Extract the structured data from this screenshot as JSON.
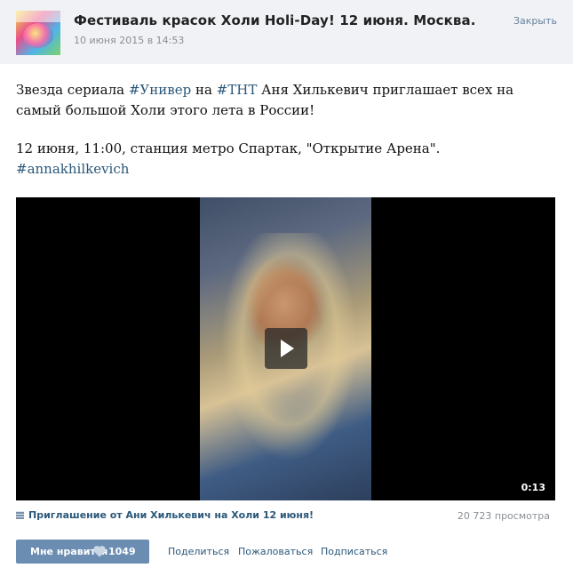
{
  "post": {
    "title": "Фестиваль красок Холи Holi-Day! 12 июня. Москва.",
    "date": "10 июня 2015 в 14:53",
    "close_label": "Закрыть",
    "text": {
      "l1_a": "Звезда сериала ",
      "tag_univer": "#Универ",
      "l1_b": " на ",
      "tag_tnt": "#ТНТ",
      "l1_c": " Аня Хилькевич приглашает всех на самый большой Холи этого лета в России!",
      "l2": "12 июня, 11:00, станция метро Спартак, \"Открытие Арена\".",
      "tag_anna": "#annakhilkevich"
    }
  },
  "video": {
    "duration": "0:13",
    "caption": "Приглашение от Ани Хилькевич на Холи 12 июня!",
    "views": "20 723 просмотра"
  },
  "actions": {
    "like_label": "Мне нравится",
    "like_count": "1049",
    "share": "Поделиться",
    "report": "Пожаловаться",
    "subscribe": "Подписаться"
  },
  "colors": {
    "link": "#2b587a",
    "header_bg": "#f0f2f5",
    "like_button": "#6b8db2"
  }
}
